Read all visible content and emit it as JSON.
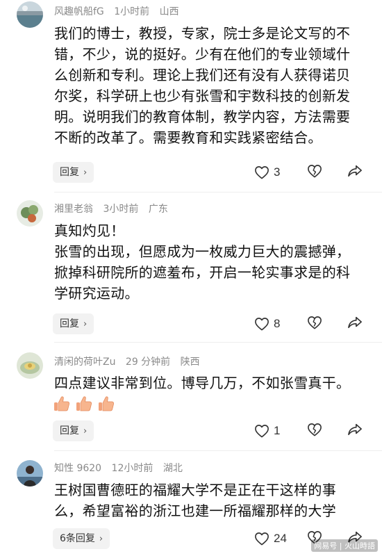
{
  "comments": [
    {
      "user": "风趣帆船fG",
      "time": "1小时前",
      "location": "山西",
      "lines": [
        "我们的博士，教授，专家，院士多是论文写的不",
        "错，不少，说的挺好。少有在他们的专业领域什",
        "么创新和专利。理论上我们还有没有人获得诺贝",
        "尔奖，科学研上也少有张雪和宇数科技的创新发",
        "明。说明我们的教育体制，教学内容，方法需要",
        "不断的改革了。需要教育和实践紧密结合。"
      ],
      "reply_label": "回复",
      "likes": "3"
    },
    {
      "user": "湘里老翁",
      "time": "3小时前",
      "location": "广东",
      "lines": [
        "真知灼见！",
        "张雪的出现，但愿成为一枚威力巨大的震撼弹，",
        "掀掉科研院所的遮羞布，开启一轮实事求是的科",
        "学研究运动。"
      ],
      "reply_label": "回复",
      "likes": "8"
    },
    {
      "user": "清闲的荷叶Zu",
      "time": "29 分钟前",
      "location": "陕西",
      "lines": [
        "四点建议非常到位。博导几万，不如张雪真干。"
      ],
      "emoji": [
        "thumbs-up",
        "thumbs-up",
        "thumbs-up"
      ],
      "reply_label": "回复",
      "likes": "1"
    },
    {
      "user": "知性 9620",
      "time": "12小时前",
      "location": "湖北",
      "lines": [
        "王树国曹德旺的福耀大学不是正在干这样的事",
        "么，希望富裕的浙江也建一所福耀那样的大学"
      ],
      "reply_label": "6条回复",
      "likes": "24"
    }
  ],
  "watermark": "网易号 | 火山時語",
  "colors": {
    "meta_text": "#8a8a8a",
    "reply_bg": "#f2f2f2",
    "icon": "#333333"
  }
}
